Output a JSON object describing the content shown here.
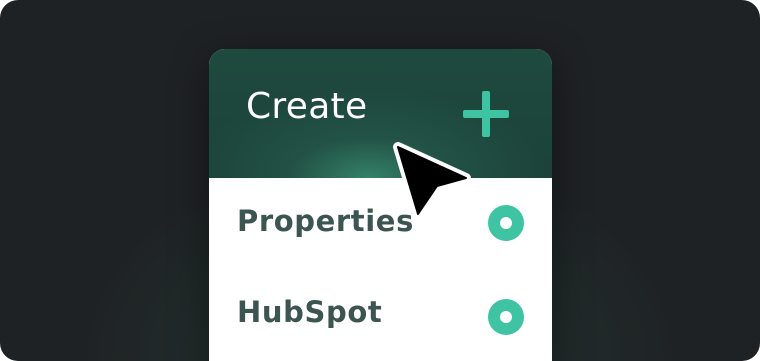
{
  "header": {
    "title": "Create",
    "add_icon": "plus-icon"
  },
  "menu": {
    "items": [
      {
        "label": "Properties",
        "icon": "radio-dot-icon"
      },
      {
        "label": "HubSpot",
        "icon": "radio-dot-icon"
      }
    ]
  },
  "cursor": {
    "icon": "arrow-cursor-icon"
  },
  "colors": {
    "background": "#1f2224",
    "header": "#1e4a3e",
    "accent": "#3ec4a2",
    "text_dark": "#3c5550"
  }
}
